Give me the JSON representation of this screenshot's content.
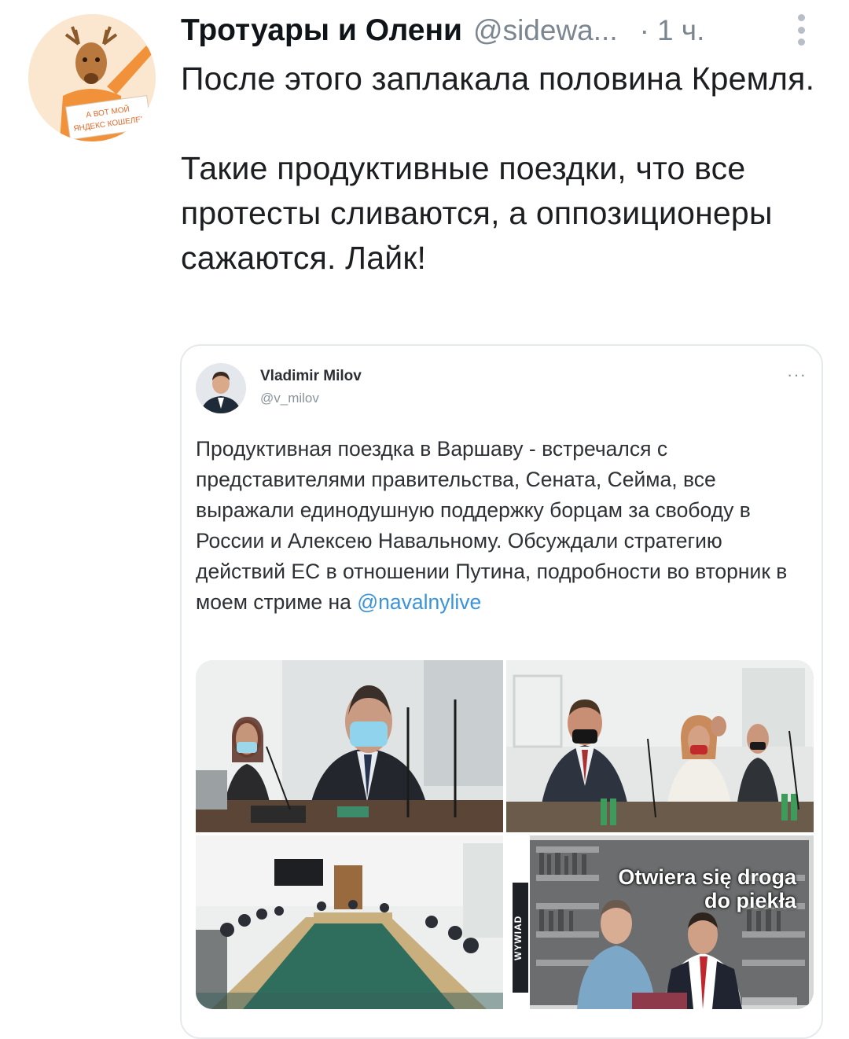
{
  "tweet": {
    "author_name": "Тротуары и Олени",
    "author_handle": "@sidewa...",
    "separator": "·",
    "time": "1 ч.",
    "paragraphs": [
      "После этого заплакала половина Кремля.",
      "Такие продуктивные поездки, что все протесты сливаются, а оппозиционеры сажаются. Лайк!"
    ],
    "avatar": {
      "sign_line_1": "А ВОТ МОЙ",
      "sign_line_2": "ЯНДЕКС КОШЕЛЕК"
    }
  },
  "quoted": {
    "author_name": "Vladimir Milov",
    "author_handle": "@v_milov",
    "more_label": "···",
    "text": "Продуктивная поездка в Варшаву - встречался с представителями правительства, Сената, Сейма, все выражали единодушную поддержку борцам за свободу в России и Алексею Навальному. Обсуждали стратегию действий ЕС в отношении Путина, подробности во вторник в моем стриме на ",
    "mention": "@navalnylive",
    "images": [
      {
        "alt": "Man in mask at meeting table with microphones"
      },
      {
        "alt": "Delegation seated at conference table"
      },
      {
        "alt": "Large meeting room with long tables"
      },
      {
        "alt": "Interview in library",
        "overlay_line_1": "Otwiera się droga",
        "overlay_line_2": "do piekła",
        "side_label": "WYWIAD"
      }
    ]
  },
  "colors": {
    "text": "#0f1419",
    "secondary": "#7b8691",
    "link": "#3b94d9",
    "avatar_shirt": "#f1923a",
    "border": "#e6e9ec"
  }
}
